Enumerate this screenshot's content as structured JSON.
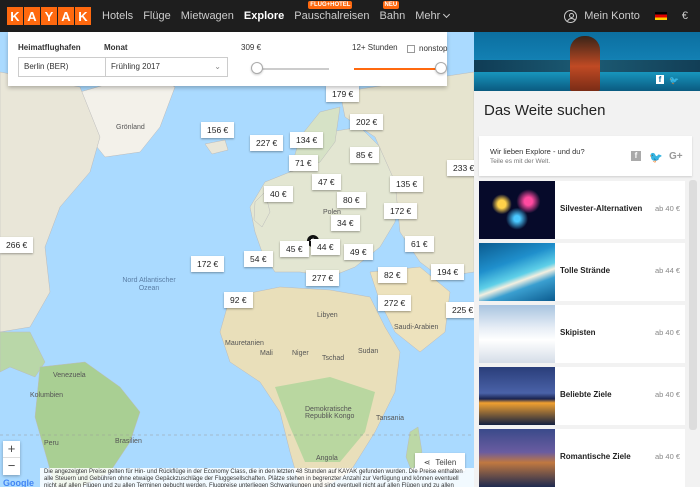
{
  "brand": {
    "letters": [
      "K",
      "A",
      "Y",
      "A",
      "K"
    ],
    "accent": "#ff690f"
  },
  "nav": {
    "items": [
      {
        "label": "Hotels"
      },
      {
        "label": "Flüge"
      },
      {
        "label": "Mietwagen"
      },
      {
        "label": "Explore",
        "active": true
      },
      {
        "label": "Pauschalreisen",
        "badge": "FLUG+HOTEL"
      },
      {
        "label": "Bahn",
        "badge": "NEU"
      },
      {
        "label": "Mehr"
      }
    ],
    "account": "Mein Konto",
    "currency": "€"
  },
  "filters": {
    "airport_label": "Heimatflughafen",
    "airport_value": "Berlin (BER)",
    "month_label": "Monat",
    "month_value": "Frühling 2017",
    "price_value": "309 €",
    "duration_value": "12+ Stunden",
    "nonstop_label": "nonstop",
    "nonstop_checked": false
  },
  "map": {
    "prices": [
      "179 €",
      "202 €",
      "156 €",
      "227 €",
      "134 €",
      "85 €",
      "233 €",
      "71 €",
      "47 €",
      "135 €",
      "40 €",
      "80 €",
      "172 €",
      "34 €",
      "61 €",
      "266 €",
      "45 €",
      "44 €",
      "49 €",
      "172 €",
      "54 €",
      "277 €",
      "82 €",
      "194 €",
      "92 €",
      "272 €",
      "225 €"
    ],
    "labels": [
      "Grönland",
      "Nord Atlantischer Ozean",
      "Libyen",
      "Sudan",
      "Saudi-Arabien",
      "Niger",
      "Tschad",
      "Mauretanien",
      "Mali",
      "Venezuela",
      "Kolumbien",
      "Demokratische Republik Kongo",
      "Tansania",
      "Angola",
      "Polen",
      "Peru",
      "Brasilien"
    ],
    "zoom_in": "+",
    "zoom_out": "−",
    "google": "Google",
    "share_label": "Teilen",
    "disclaimer": "Die angezeigten Preise gelten für Hin- und Rückflüge in der Economy Class, die in den letzten 48 Stunden auf KAYAK gefunden wurden. Die Preise enthalten alle Steuern und Gebühren ohne etwaige Gepäckzuschläge der Fluggesellschaften. Plätze stehen in begrenzter Anzahl zur Verfügung und können eventuell nicht auf allen Flügen und zu allen Terminen gebucht werden. Flugpreise unterliegen Schwankungen und sind eventuell nicht auf allen Flügen und zu allen Terminen verfügbar."
  },
  "panel": {
    "title": "Das Weite suchen",
    "share_question": "Wir lieben Explore - und du?",
    "share_sub": "Teile es mit der Welt.",
    "categories": [
      {
        "name": "Silvester-Alternativen",
        "price": "ab 40 €"
      },
      {
        "name": "Tolle Strände",
        "price": "ab 44 €"
      },
      {
        "name": "Skipisten",
        "price": "ab 40 €"
      },
      {
        "name": "Beliebte Ziele",
        "price": "ab 40 €"
      },
      {
        "name": "Romantische Ziele",
        "price": "ab 40 €"
      }
    ]
  }
}
